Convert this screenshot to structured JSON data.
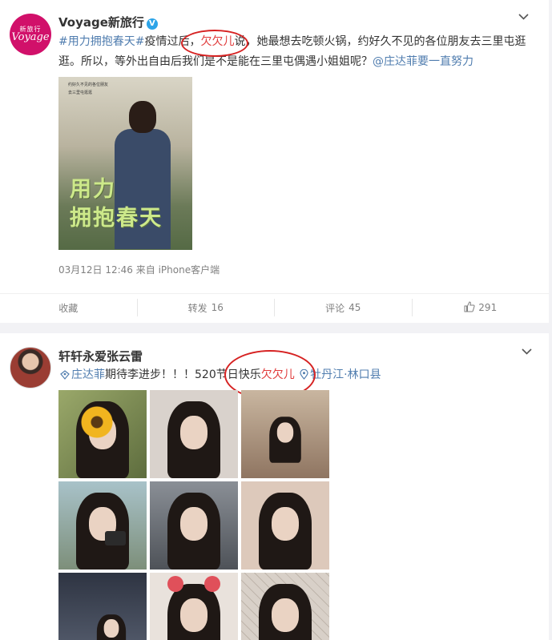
{
  "post1": {
    "avatar_text_cn": "新旅行",
    "avatar_text_en": "Voyage",
    "username": "Voyage新旅行",
    "verified_badge": "V",
    "text_parts": {
      "hashtag": "#用力拥抱春天#",
      "t1": "疫情过后，",
      "mention_name": "欠欠儿",
      "t2": "说，她最想去吃顿火锅，约好久不见的各位朋友去三里屯逛逛。所以，等外出自由后我们是不是能在三里屯偶遇小姐姐呢？",
      "at_user": "@庄达菲",
      "t3": "要一直努力"
    },
    "image": {
      "small_lines": [
        "约好久不见的各位朋友",
        "去三里屯逛逛"
      ],
      "big_lines": [
        "用力",
        "拥抱春天"
      ]
    },
    "timestamp": "03月12日 12:46",
    "source": "来自 iPhone客户端",
    "actions": {
      "favorite": "收藏",
      "repost_label": "转发",
      "repost_count": "16",
      "comment_label": "评论",
      "comment_count": "45",
      "like_count": "291"
    }
  },
  "post2": {
    "username": "轩轩永爱张云雷",
    "text_parts": {
      "super_topic": "庄达菲",
      "t1": "期待李进步！！！520节日快乐",
      "mention_name": "欠欠儿",
      "location": "牡丹江·林口县"
    },
    "photos": [
      {
        "name": "photo-sunflower",
        "bg": "#8a9b5b"
      },
      {
        "name": "photo-selfie-1",
        "bg": "#cfc8c2"
      },
      {
        "name": "photo-room",
        "bg": "#b8a18c"
      },
      {
        "name": "photo-camera",
        "bg": "#8fb0b8"
      },
      {
        "name": "photo-car",
        "bg": "#7a7f86"
      },
      {
        "name": "photo-selfie-2",
        "bg": "#d8c3b4"
      },
      {
        "name": "photo-night",
        "bg": "#3a3f4a"
      },
      {
        "name": "photo-headband",
        "bg": "#e4ddd7"
      },
      {
        "name": "photo-net",
        "bg": "#d6cfc7"
      }
    ]
  },
  "colors": {
    "link_blue": "#507daf",
    "highlight_red": "#e03a3a",
    "circle_red": "#d62222",
    "meta_gray": "#808080"
  }
}
